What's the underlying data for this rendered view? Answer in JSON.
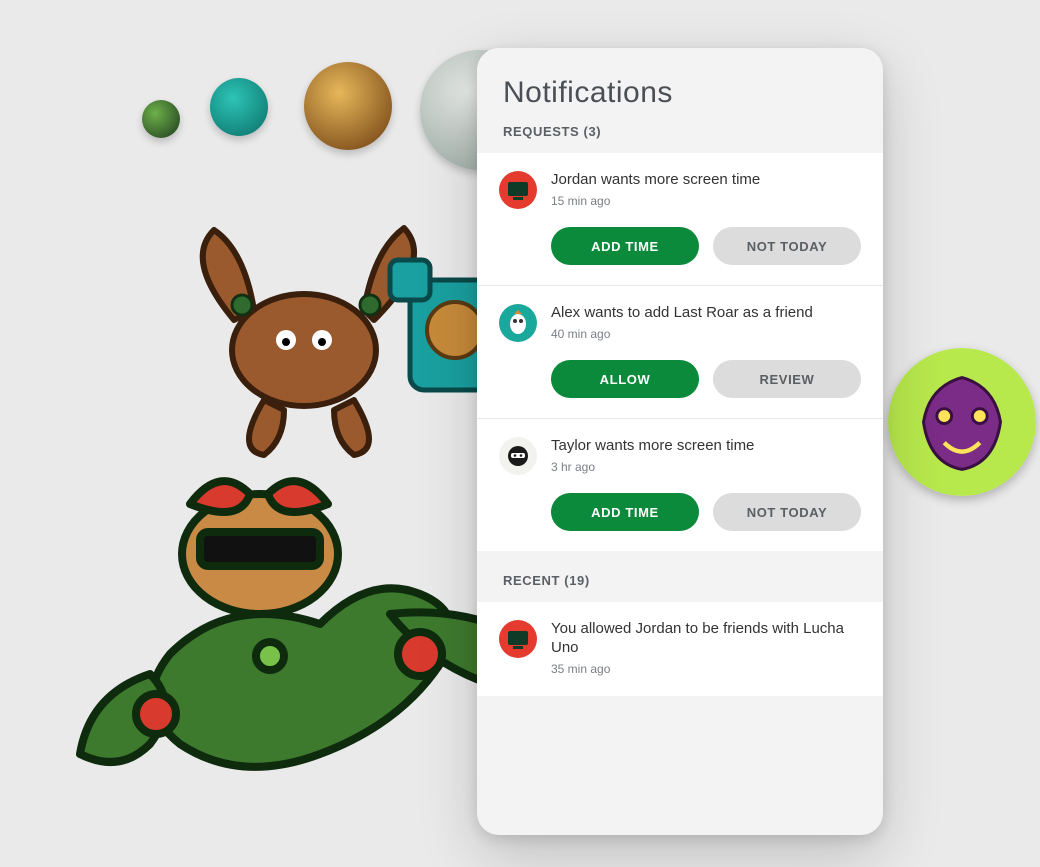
{
  "panel": {
    "title": "Notifications",
    "requests_label": "REQUESTS",
    "requests_count": "(3)",
    "recent_label": "RECENT",
    "recent_count": "(19)"
  },
  "requests": [
    {
      "avatar": "red-monitor",
      "message": "Jordan wants more screen time",
      "time": "15 min ago",
      "primary": "ADD TIME",
      "secondary": "NOT TODAY"
    },
    {
      "avatar": "teal-owl",
      "message": "Alex wants to add Last Roar as a friend",
      "time": "40 min ago",
      "primary": "ALLOW",
      "secondary": "REVIEW"
    },
    {
      "avatar": "white-ninja",
      "message": "Taylor wants more screen time",
      "time": "3 hr ago",
      "primary": "ADD TIME",
      "secondary": "NOT TODAY"
    }
  ],
  "recent": [
    {
      "avatar": "red-monitor",
      "message": "You allowed Jordan to be friends with Lucha Uno",
      "time": "35 min ago"
    }
  ],
  "bg_bubbles": [
    {
      "name": "ninja-small",
      "color1": "#2e6b2e",
      "color2": "#1a3a1a"
    },
    {
      "name": "owl-teal",
      "color1": "#1aa79c",
      "color2": "#0b6e66"
    },
    {
      "name": "viking",
      "color1": "#d9a441",
      "color2": "#6b3a0f"
    },
    {
      "name": "polar",
      "color1": "#cfd6d0",
      "color2": "#8fa09a"
    },
    {
      "name": "bear-bubble",
      "color1": "#b7e84c",
      "color2": "#6b2c74"
    }
  ]
}
